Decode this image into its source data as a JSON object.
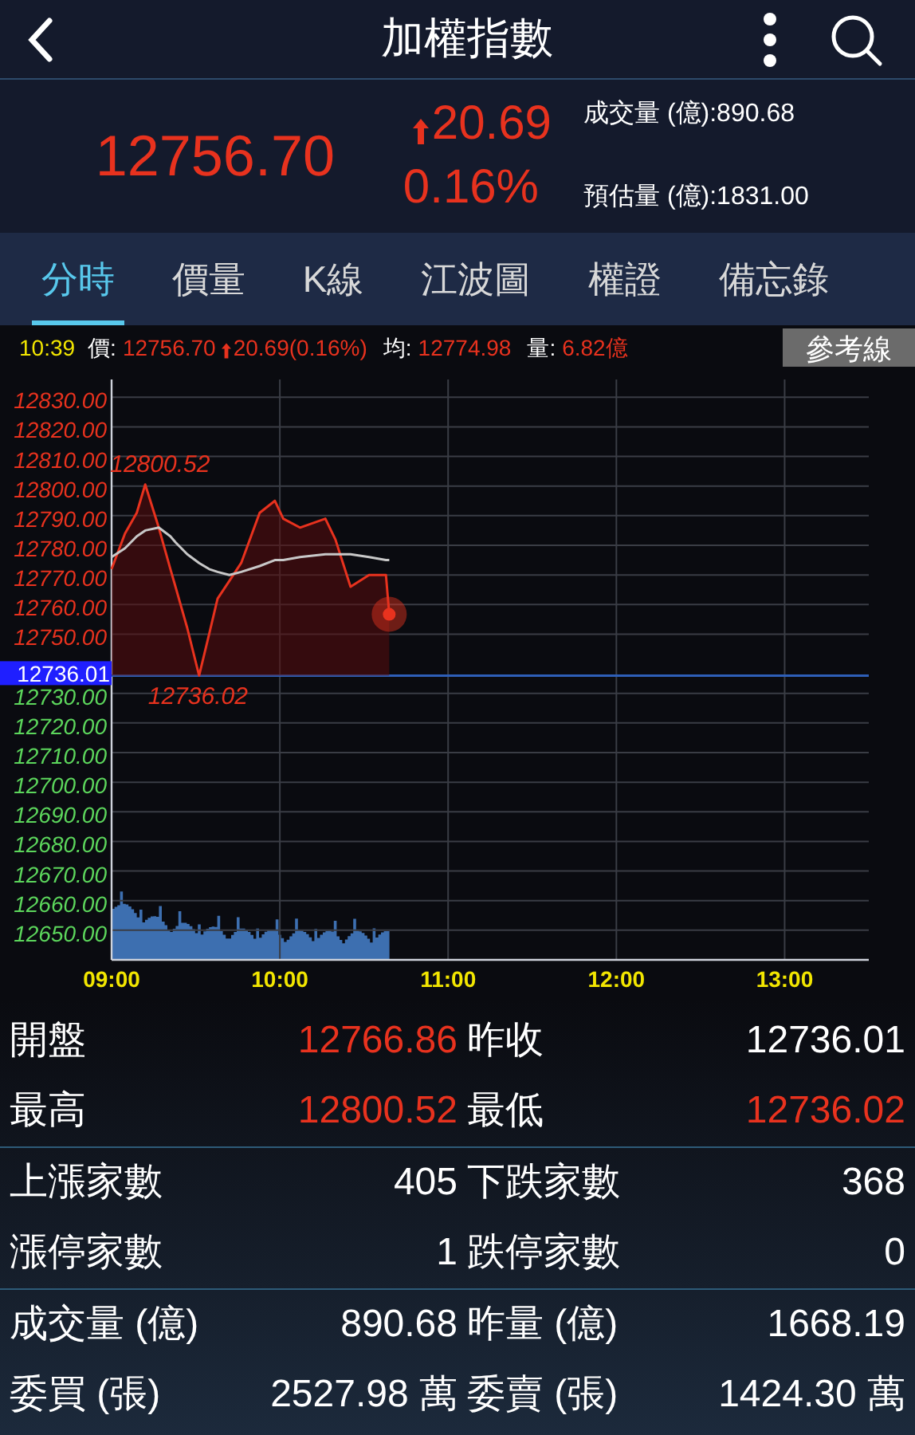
{
  "header": {
    "title": "加權指數"
  },
  "quote": {
    "price": "12756.70",
    "change": "20.69",
    "percent": "0.16%",
    "volume": "成交量 (億):890.68",
    "estimate": "預估量 (億):1831.00"
  },
  "tabs": [
    {
      "label": "分時",
      "selected": true
    },
    {
      "label": "價量",
      "selected": false
    },
    {
      "label": "K線",
      "selected": false
    },
    {
      "label": "江波圖",
      "selected": false
    },
    {
      "label": "權證",
      "selected": false
    },
    {
      "label": "備忘錄",
      "selected": false
    }
  ],
  "info_bar": {
    "time": "10:39",
    "price_label": "價:",
    "price": "12756.70",
    "change": "20.69(0.16%)",
    "avg_label": "均:",
    "avg": "12774.98",
    "vol_label": "量:",
    "vol": "6.82億",
    "button": "參考線"
  },
  "chart": {
    "chart_data": {
      "type": "line",
      "x": [
        9,
        9.08,
        9.15,
        9.2,
        9.28,
        9.35,
        9.38,
        9.45,
        9.52,
        9.58,
        9.63,
        9.7,
        9.77,
        9.88,
        9.97,
        10.02,
        10.12,
        10.27,
        10.33,
        10.42,
        10.53,
        10.63,
        10.65
      ],
      "series": [
        {
          "color": "#e8321e",
          "values": [
            12772,
            12784,
            12791,
            12800.5,
            12786,
            12772,
            12766,
            12752,
            12736,
            12750,
            12762,
            12768,
            12774,
            12791,
            12795,
            12789,
            12786,
            12789,
            12782,
            12766,
            12770,
            12770,
            12756.7
          ]
        },
        {
          "color": "#c8c8c8",
          "values": [
            12776,
            12779,
            12783,
            12785,
            12786,
            12783,
            12781,
            12777,
            12774,
            12772,
            12771,
            12770,
            12771,
            12773,
            12775,
            12775,
            12776,
            12777,
            12777,
            12777,
            12776,
            12775,
            12775
          ]
        }
      ],
      "xlim": [
        9,
        13.5
      ],
      "ylim": [
        12640,
        12836
      ],
      "grid": true,
      "xticks": [
        {
          "value": 9,
          "label": "09:00"
        },
        {
          "value": 10,
          "label": "10:00"
        },
        {
          "value": 11,
          "label": "11:00"
        },
        {
          "value": 12,
          "label": "12:00"
        },
        {
          "value": 13,
          "label": "13:00"
        }
      ],
      "yticks": [
        {
          "value": 12830,
          "label": "12830.00"
        },
        {
          "value": 12820,
          "label": "12820.00"
        },
        {
          "value": 12810,
          "label": "12810.00"
        },
        {
          "value": 12800,
          "label": "12800.00"
        },
        {
          "value": 12790,
          "label": "12790.00"
        },
        {
          "value": 12780,
          "label": "12780.00"
        },
        {
          "value": 12770,
          "label": "12770.00"
        },
        {
          "value": 12760,
          "label": "12760.00"
        },
        {
          "value": 12750,
          "label": "12750.00"
        },
        {
          "value": 12730,
          "label": "12730.00"
        },
        {
          "value": 12720,
          "label": "12720.00"
        },
        {
          "value": 12710,
          "label": "12710.00"
        },
        {
          "value": 12700,
          "label": "12700.00"
        },
        {
          "value": 12690,
          "label": "12690.00"
        },
        {
          "value": 12680,
          "label": "12680.00"
        },
        {
          "value": 12670,
          "label": "12670.00"
        },
        {
          "value": 12660,
          "label": "12660.00"
        },
        {
          "value": 12650,
          "label": "12650.00"
        }
      ],
      "annotations": [
        {
          "text": "12800.52",
          "x": 9.2,
          "y": 12800.5
        },
        {
          "text": "12736.02",
          "x": 9.52,
          "y": 12736
        }
      ],
      "ref_lines": [
        {
          "axis": "y",
          "value": 12736.01,
          "label": "12736.01",
          "color": "#2e5fb8"
        }
      ]
    }
  },
  "stats": [
    [
      [
        {
          "label": "開盤",
          "value": "12766.86",
          "color": "#e8321e"
        },
        {
          "label": "昨收",
          "value": "12736.01",
          "color": "#ffffff"
        }
      ],
      [
        {
          "label": "最高",
          "value": "12800.52",
          "color": "#e8321e"
        },
        {
          "label": "最低",
          "value": "12736.02",
          "color": "#e8321e"
        }
      ]
    ],
    [
      [
        {
          "label": "上漲家數",
          "value": "405",
          "color": "#ffffff"
        },
        {
          "label": "下跌家數",
          "value": "368",
          "color": "#ffffff"
        }
      ],
      [
        {
          "label": "漲停家數",
          "value": "1",
          "color": "#ffffff"
        },
        {
          "label": "跌停家數",
          "value": "0",
          "color": "#ffffff"
        }
      ]
    ],
    [
      [
        {
          "label": "成交量 (億)",
          "value": "890.68",
          "color": "#ffffff"
        },
        {
          "label": "昨量 (億)",
          "value": "1668.19",
          "color": "#ffffff"
        }
      ],
      [
        {
          "label": "委買 (張)",
          "value": "2527.98 萬",
          "color": "#ffffff"
        },
        {
          "label": "委賣 (張)",
          "value": "1424.30 萬",
          "color": "#ffffff"
        }
      ]
    ]
  ]
}
